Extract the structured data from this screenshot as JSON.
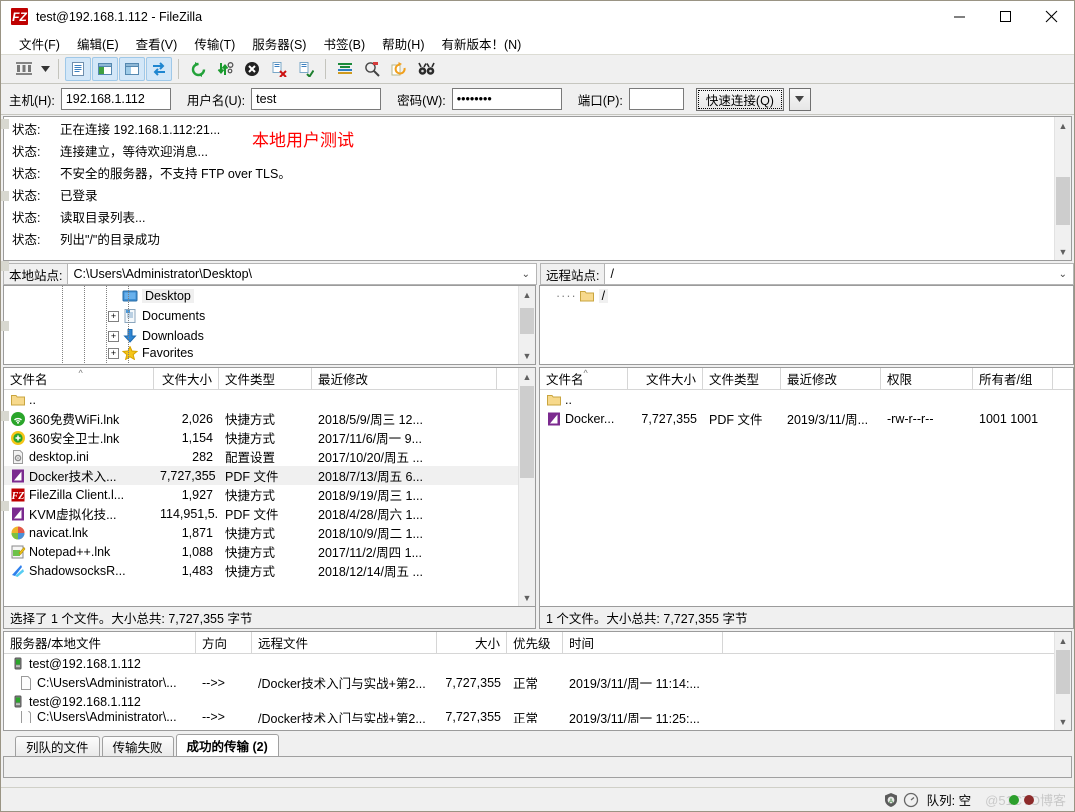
{
  "window": {
    "title": "test@192.168.1.112 - FileZilla",
    "logo_text": "FZ",
    "minimize": "minimize-icon",
    "maximize": "maximize-icon",
    "close": "close-icon"
  },
  "menu": [
    {
      "label": "文件(F)"
    },
    {
      "label": "编辑(E)"
    },
    {
      "label": "查看(V)"
    },
    {
      "label": "传输(T)"
    },
    {
      "label": "服务器(S)"
    },
    {
      "label": "书签(B)"
    },
    {
      "label": "帮助(H)"
    },
    {
      "label": "有新版本！(N)"
    }
  ],
  "toolbar": {
    "buttons": [
      {
        "name": "site-manager-icon"
      },
      {
        "name": "site-manager-dropdown-icon"
      },
      {
        "name": "toggle-message-log-icon"
      },
      {
        "name": "toggle-local-tree-icon"
      },
      {
        "name": "toggle-remote-tree-icon"
      },
      {
        "name": "toggle-transfer-queue-icon"
      },
      {
        "name": "refresh-icon"
      },
      {
        "name": "process-queue-icon"
      },
      {
        "name": "cancel-icon"
      },
      {
        "name": "disconnect-icon"
      },
      {
        "name": "reconnect-icon"
      },
      {
        "name": "filter-icon"
      },
      {
        "name": "compare-directories-icon"
      },
      {
        "name": "synchronized-browsing-icon"
      },
      {
        "name": "find-files-icon"
      }
    ]
  },
  "connection": {
    "host_label": "主机(H):",
    "host_value": "192.168.1.112",
    "user_label": "用户名(U):",
    "user_value": "test",
    "pass_label": "密码(W):",
    "pass_value": "••••••••",
    "port_label": "端口(P):",
    "port_value": "",
    "quick_connect": "快速连接(Q)",
    "quick_connect_dropdown": "chevron-down-icon"
  },
  "log": {
    "rows": [
      {
        "key": "状态:",
        "text": "正在连接 192.168.1.112:21..."
      },
      {
        "key": "状态:",
        "text": "连接建立，等待欢迎消息..."
      },
      {
        "key": "状态:",
        "text": "不安全的服务器，不支持 FTP over TLS。"
      },
      {
        "key": "状态:",
        "text": "已登录"
      },
      {
        "key": "状态:",
        "text": "读取目录列表..."
      },
      {
        "key": "状态:",
        "text": "列出\"/\"的目录成功"
      }
    ],
    "annotation": "本地用户测试",
    "annotation_color": "#ff0000"
  },
  "local": {
    "site_label": "本地站点:",
    "site_value": "C:\\Users\\Administrator\\Desktop\\",
    "tree": [
      {
        "label": "Desktop",
        "icon": "desktop-icon",
        "expander": "",
        "selected": true,
        "indent": 66
      },
      {
        "label": "Documents",
        "icon": "documents-icon",
        "expander": "+",
        "selected": false,
        "indent": 52
      },
      {
        "label": "Downloads",
        "icon": "downloads-icon",
        "expander": "+",
        "selected": false,
        "indent": 52
      },
      {
        "label": "Favorites",
        "icon": "favorites-icon",
        "expander": "+",
        "selected": false,
        "indent": 52
      }
    ],
    "columns": [
      {
        "label": "文件名",
        "width": 150,
        "align": "left",
        "sorted": true
      },
      {
        "label": "文件大小",
        "width": 65,
        "align": "right"
      },
      {
        "label": "文件类型",
        "width": 93,
        "align": "left"
      },
      {
        "label": "最近修改",
        "width": 185,
        "align": "left"
      }
    ],
    "rows": [
      {
        "icon": "folder-icon",
        "name": "..",
        "size": "",
        "type": "",
        "modified": "",
        "selected": false
      },
      {
        "icon": "360-wifi-icon",
        "name": "360免费WiFi.lnk",
        "size": "2,026",
        "type": "快捷方式",
        "modified": "2018/5/9/周三 12...",
        "selected": false
      },
      {
        "icon": "360-safe-icon",
        "name": "360安全卫士.lnk",
        "size": "1,154",
        "type": "快捷方式",
        "modified": "2017/11/6/周一 9...",
        "selected": false
      },
      {
        "icon": "ini-file-icon",
        "name": "desktop.ini",
        "size": "282",
        "type": "配置设置",
        "modified": "2017/10/20/周五 ...",
        "selected": false
      },
      {
        "icon": "pdf-file-icon",
        "name": "Docker技术入...",
        "size": "7,727,355",
        "type": "PDF 文件",
        "modified": "2018/7/13/周五 6...",
        "selected": true
      },
      {
        "icon": "filezilla-icon",
        "name": "FileZilla Client.l...",
        "size": "1,927",
        "type": "快捷方式",
        "modified": "2018/9/19/周三 1...",
        "selected": false
      },
      {
        "icon": "pdf-file-icon",
        "name": "KVM虚拟化技...",
        "size": "114,951,5...",
        "type": "PDF 文件",
        "modified": "2018/4/28/周六 1...",
        "selected": false
      },
      {
        "icon": "navicat-icon",
        "name": "navicat.lnk",
        "size": "1,871",
        "type": "快捷方式",
        "modified": "2018/10/9/周二 1...",
        "selected": false
      },
      {
        "icon": "notepadpp-icon",
        "name": "Notepad++.lnk",
        "size": "1,088",
        "type": "快捷方式",
        "modified": "2017/11/2/周四 1...",
        "selected": false
      },
      {
        "icon": "shadowsocks-icon",
        "name": "ShadowsocksR...",
        "size": "1,483",
        "type": "快捷方式",
        "modified": "2018/12/14/周五 ...",
        "selected": false
      }
    ],
    "status": "选择了 1 个文件。大小总共: 7,727,355 字节"
  },
  "remote": {
    "site_label": "远程站点:",
    "site_value": "/",
    "tree": [
      {
        "label": "/",
        "icon": "folder-icon",
        "selected": true
      }
    ],
    "columns": [
      {
        "label": "文件名",
        "width": 88,
        "align": "left",
        "sorted": true
      },
      {
        "label": "文件大小",
        "width": 75,
        "align": "right"
      },
      {
        "label": "文件类型",
        "width": 78,
        "align": "left"
      },
      {
        "label": "最近修改",
        "width": 100,
        "align": "left"
      },
      {
        "label": "权限",
        "width": 92,
        "align": "left"
      },
      {
        "label": "所有者/组",
        "width": 80,
        "align": "left"
      }
    ],
    "rows": [
      {
        "icon": "folder-icon",
        "name": "..",
        "size": "",
        "type": "",
        "modified": "",
        "perms": "",
        "owner": ""
      },
      {
        "icon": "pdf-file-icon",
        "name": "Docker...",
        "size": "7,727,355",
        "type": "PDF 文件",
        "modified": "2019/3/11/周...",
        "perms": "-rw-r--r--",
        "owner": "1001 1001"
      }
    ],
    "status": "1 个文件。大小总共: 7,727,355 字节"
  },
  "queue": {
    "columns": [
      {
        "label": "服务器/本地文件",
        "width": 192,
        "align": "left"
      },
      {
        "label": "方向",
        "width": 56,
        "align": "left"
      },
      {
        "label": "远程文件",
        "width": 185,
        "align": "left"
      },
      {
        "label": "大小",
        "width": 70,
        "align": "right"
      },
      {
        "label": "优先级",
        "width": 56,
        "align": "left"
      },
      {
        "label": "时间",
        "width": 160,
        "align": "left"
      }
    ],
    "rows": [
      {
        "kind": "server",
        "icon": "server-icon",
        "server": "test@192.168.1.112"
      },
      {
        "kind": "file",
        "icon": "file-icon",
        "local": "C:\\Users\\Administrator\\...",
        "dir": "-->>",
        "remote": "/Docker技术入门与实战+第2...",
        "size": "7,727,355",
        "priority": "正常",
        "time": "2019/3/11/周一 11:14:..."
      },
      {
        "kind": "server",
        "icon": "server-icon",
        "server": "test@192.168.1.112"
      },
      {
        "kind": "file",
        "icon": "file-icon",
        "local": "C:\\Users\\Administrator\\...",
        "dir": "-->>",
        "remote": "/Docker技术入门与实战+第2...",
        "size": "7,727,355",
        "priority": "正常",
        "time": "2019/3/11/周一 11:25:..."
      }
    ]
  },
  "tabs": [
    {
      "label": "列队的文件",
      "active": false
    },
    {
      "label": "传输失败",
      "active": false
    },
    {
      "label": "成功的传输 (2)",
      "active": true
    }
  ],
  "statusbar": {
    "tls_icon": "lock-shield-icon",
    "speed_icon": "speed-gauge-icon",
    "queue_text": "队列: 空",
    "watermark": "@51CTO博客"
  }
}
